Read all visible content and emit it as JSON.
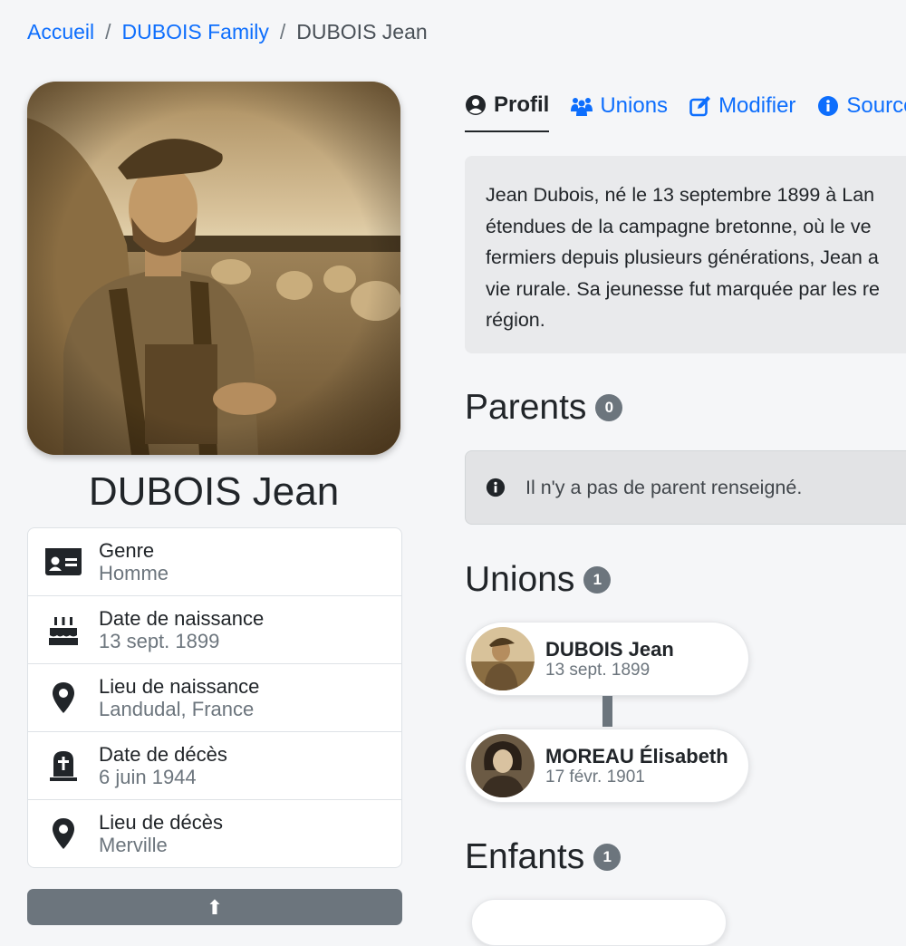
{
  "breadcrumb": {
    "items": [
      "Accueil",
      "DUBOIS Family"
    ],
    "separator": "/",
    "current": "DUBOIS Jean"
  },
  "person": {
    "name": "DUBOIS Jean",
    "details": [
      {
        "label": "Genre",
        "value": "Homme",
        "icon": "id-card-icon"
      },
      {
        "label": "Date de naissance",
        "value": "13 sept. 1899",
        "icon": "birthday-cake-icon"
      },
      {
        "label": "Lieu de naissance",
        "value": "Landudal, France",
        "icon": "map-marker-icon"
      },
      {
        "label": "Date de décès",
        "value": "6 juin 1944",
        "icon": "tombstone-icon"
      },
      {
        "label": "Lieu de décès",
        "value": "Merville",
        "icon": "map-marker-icon"
      }
    ]
  },
  "tabs": [
    {
      "label": "Profil",
      "icon": "user-circle-icon",
      "active": true
    },
    {
      "label": "Unions",
      "icon": "users-icon",
      "active": false
    },
    {
      "label": "Modifier",
      "icon": "edit-icon",
      "active": false
    },
    {
      "label": "Sources",
      "icon": "info-circle-icon",
      "active": false
    }
  ],
  "biography": [
    "Jean Dubois, né le 13 septembre 1899 à Lan",
    "étendues de la campagne bretonne, où le ve",
    "fermiers depuis plusieurs générations, Jean a",
    "vie rurale. Sa jeunesse fut marquée par les re",
    "région."
  ],
  "parents": {
    "title": "Parents",
    "count": "0",
    "empty_message": "Il n'y a pas de parent renseigné."
  },
  "unions": {
    "title": "Unions",
    "count": "1",
    "members": [
      {
        "name": "DUBOIS Jean",
        "date": "13 sept. 1899"
      },
      {
        "name": "MOREAU Élisabeth",
        "date": "17 févr. 1901"
      }
    ]
  },
  "children": {
    "title": "Enfants",
    "count": "1"
  },
  "colors": {
    "link": "#0d6efd",
    "badge": "#6c757d",
    "background": "#f5f6f8",
    "sepia": "#8a6a40"
  }
}
